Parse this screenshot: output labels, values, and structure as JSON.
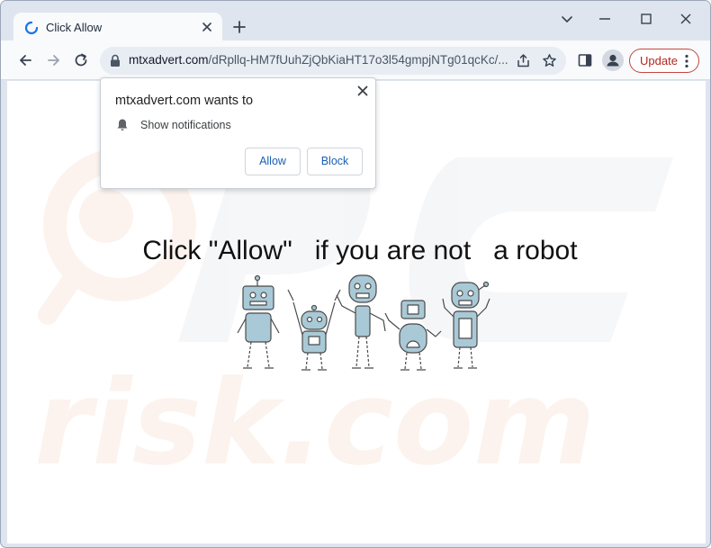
{
  "browser": {
    "tab": {
      "title": "Click Allow",
      "favicon": "loading-icon"
    },
    "new_tab_icon": "plus-icon",
    "window_controls": [
      "chevron-down-icon",
      "minimize-icon",
      "maximize-icon",
      "close-icon"
    ],
    "toolbar": {
      "nav_icons": [
        "back-arrow-icon",
        "forward-arrow-icon",
        "reload-icon"
      ],
      "url_host": "mtxadvert.com",
      "url_path": "/dRpllq-HM7fUuhZjQbKiaHT17o3l54gmpjNTg01qcKc/...",
      "update_label": "Update",
      "accent_color": "#b3261e"
    }
  },
  "popup": {
    "title": "mtxadvert.com wants to",
    "permission_text": "Show notifications",
    "allow_label": "Allow",
    "block_label": "Block",
    "button_text_color": "#1a5fb4"
  },
  "page": {
    "headline": "Click \"Allow\"   if you are not   a robot",
    "watermark_text": "risk.com"
  }
}
